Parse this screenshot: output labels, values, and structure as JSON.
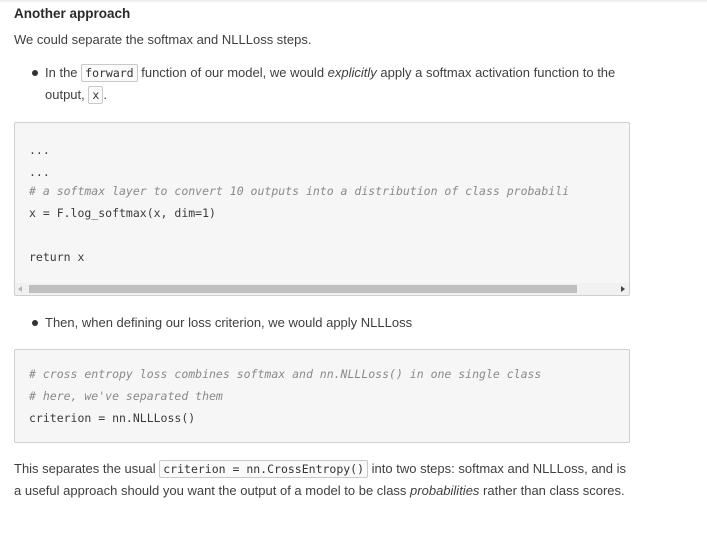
{
  "heading": "Another approach",
  "intro": "We could separate the softmax and NLLLoss steps.",
  "bullet1": {
    "pre": "In the ",
    "code1": "forward",
    "mid": " function of our model, we would ",
    "em": "explicitly",
    "post": " apply a softmax activation function to the output, ",
    "code2": "x",
    "end": "."
  },
  "code_block_1": {
    "line1": "...",
    "line2": "...",
    "line3": "# a softmax layer to convert 10 outputs into a distribution of class probabili",
    "line4": "x = F.log_softmax(x, dim=1)",
    "line5": "return x"
  },
  "bullet2": "Then, when defining our loss criterion, we would apply NLLLoss",
  "code_block_2": {
    "line1": "# cross entropy loss combines softmax and nn.NLLLoss() in one single class",
    "line2": "# here, we've separated them",
    "line3": "criterion = nn.NLLLoss()"
  },
  "final": {
    "pre": "This separates the usual ",
    "code": "criterion = nn.CrossEntropy()",
    "mid": " into two steps: softmax and NLLLoss, and is a useful approach should you want the output of a model to be class ",
    "em": "probabilities",
    "post": " rather than class scores."
  }
}
